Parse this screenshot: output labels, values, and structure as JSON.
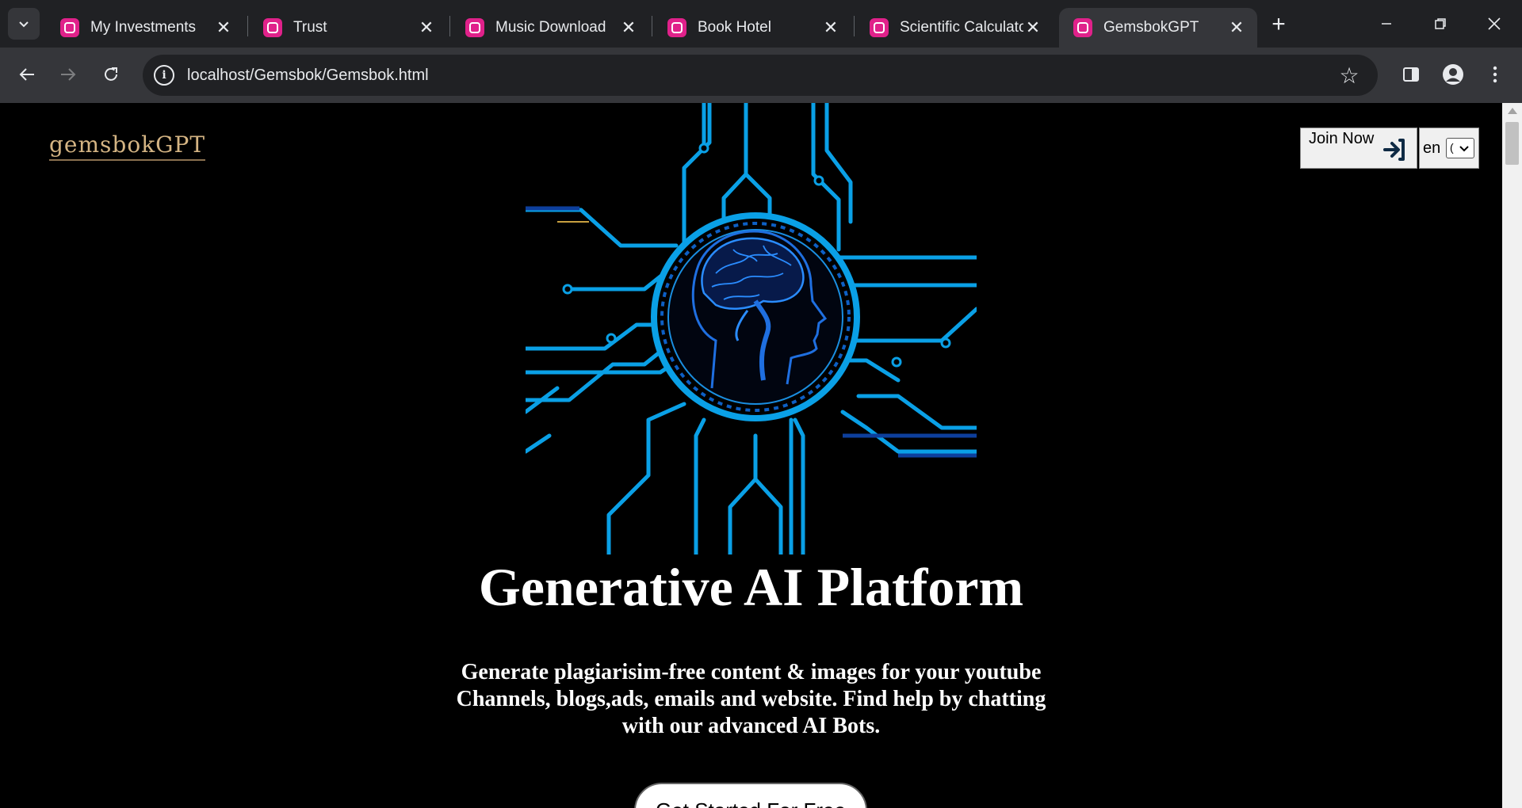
{
  "browser": {
    "tabs": [
      {
        "title": "My Investments",
        "active": false
      },
      {
        "title": "Trust",
        "active": false
      },
      {
        "title": "Music Download",
        "active": false
      },
      {
        "title": "Book Hotel",
        "active": false
      },
      {
        "title": "Scientific Calculator",
        "active": false
      },
      {
        "title": "GemsbokGPT",
        "active": true
      }
    ],
    "address": "localhost/Gemsbok/Gemsbok.html",
    "favicon_color": "#e0218a"
  },
  "page": {
    "logo": "gemsbokGPT",
    "join_label": "Join Now",
    "lang_label": "en",
    "lang_selected": "(",
    "headline": "Generative AI Platform",
    "subtext": "Generate plagiarisim-free content & images for your youtube Channels, blogs,ads, emails and website. Find help by chatting with our advanced AI Bots.",
    "cta_label": "Get Started For Free"
  },
  "colors": {
    "page_bg": "#000000",
    "circuit_blue": "#0aa0e6",
    "logo_gold": "#d4b483"
  }
}
